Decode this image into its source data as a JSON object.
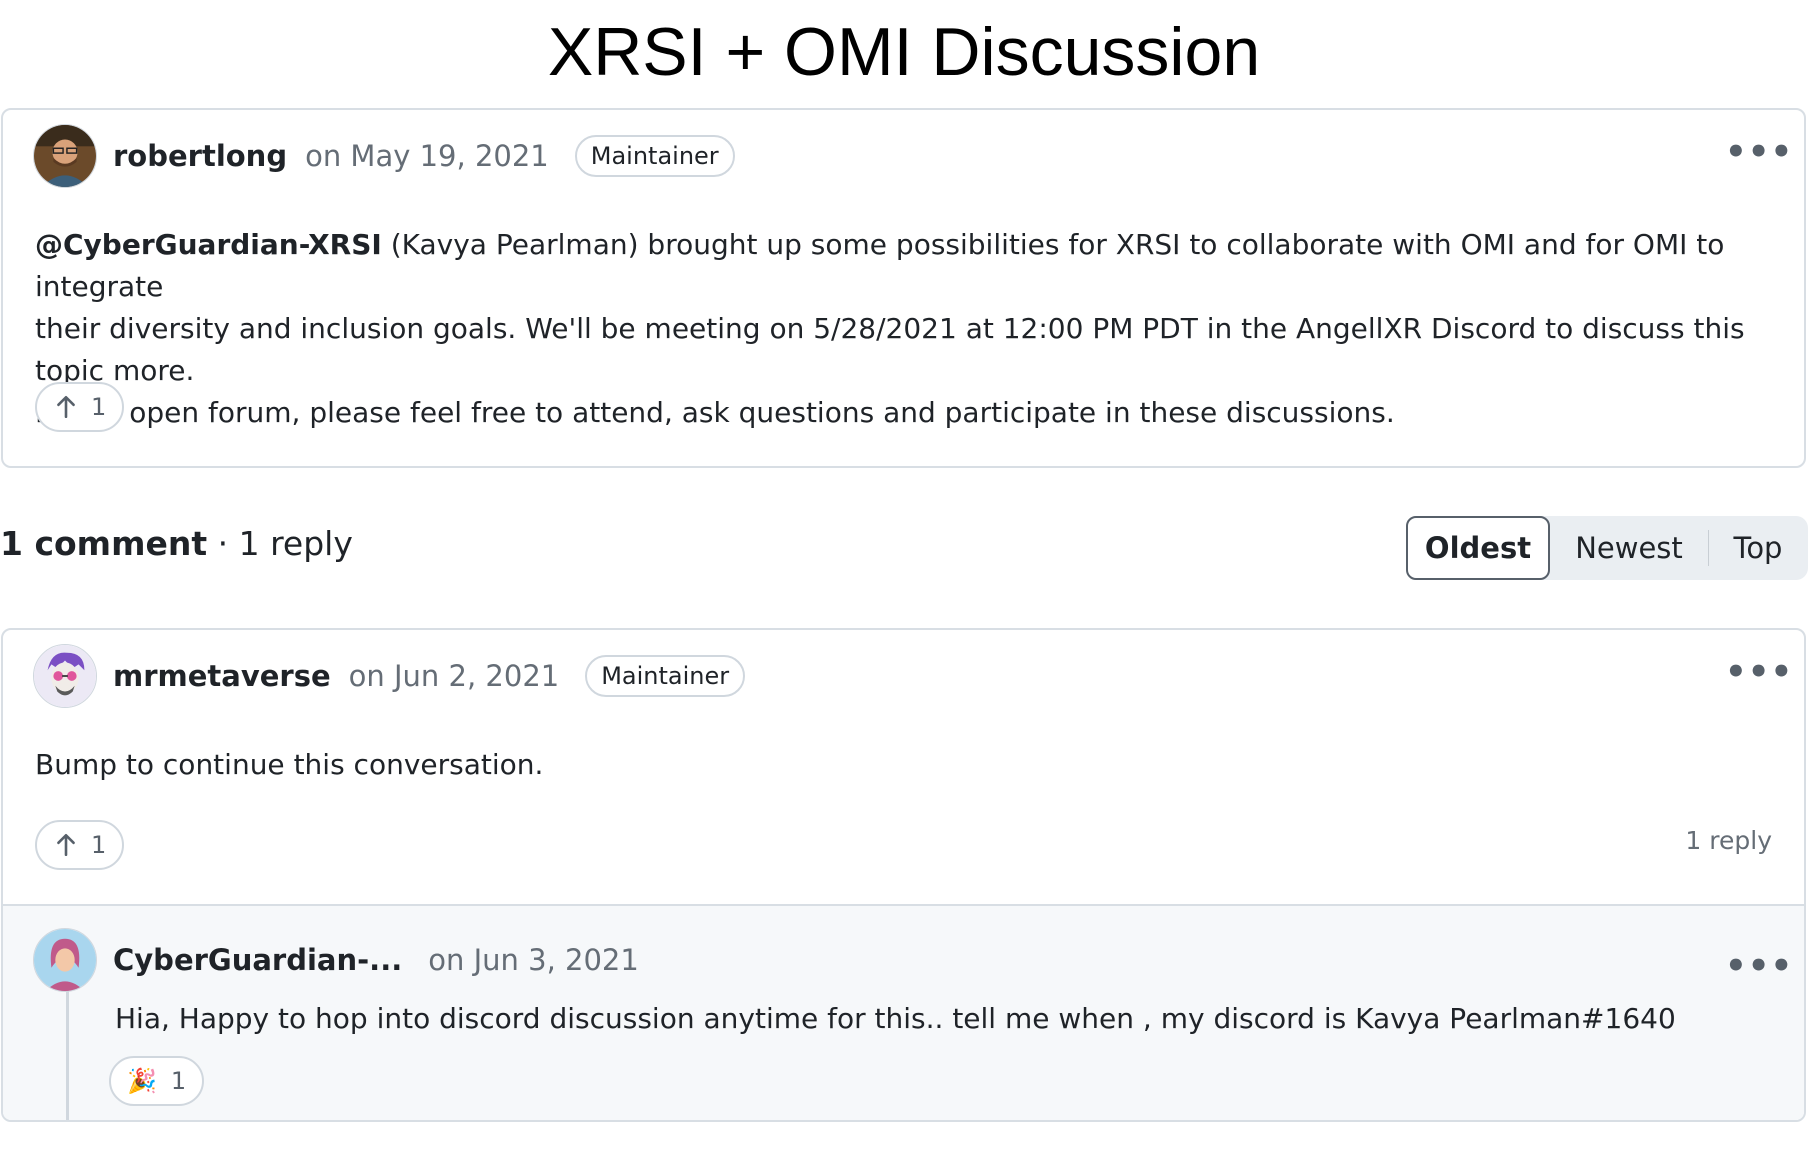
{
  "page": {
    "title": "XRSI + OMI Discussion"
  },
  "post": {
    "author": "robertlong",
    "date": "on May 19, 2021",
    "badge": "Maintainer",
    "mention": "@CyberGuardian-XRSI",
    "body_line1": " (Kavya Pearlman) brought up some possibilities for XRSI to collaborate with OMI and for OMI to integrate",
    "body_line2": "their diversity and inclusion goals. We'll be meeting on 5/28/2021 at 12:00 PM PDT in the AngellXR Discord to discuss this topic more.",
    "body_line3": "It's an open forum, please feel free to attend, ask questions and participate in these discussions.",
    "upvotes": "1",
    "more": "•••"
  },
  "summary": {
    "comments": "1 comment",
    "separator": " · ",
    "replies": "1 reply"
  },
  "sort": {
    "oldest": "Oldest",
    "newest": "Newest",
    "top": "Top",
    "active": "Oldest"
  },
  "comment": {
    "author": "mrmetaverse",
    "date": "on Jun 2, 2021",
    "badge": "Maintainer",
    "body": "Bump to continue this conversation.",
    "upvotes": "1",
    "reply_count": "1 reply",
    "more": "•••"
  },
  "reply": {
    "author": "CyberGuardian-...",
    "date": "on Jun 3, 2021",
    "body": "Hia, Happy to hop into discord discussion anytime for this.. tell me when , my discord is Kavya Pearlman#1640",
    "reaction_emoji": "🎉",
    "reaction_count": "1",
    "more": "•••"
  },
  "icons": {
    "upvote": "arrow-up-icon",
    "more": "kebab-horizontal-icon",
    "reaction": "party-popper-icon"
  }
}
